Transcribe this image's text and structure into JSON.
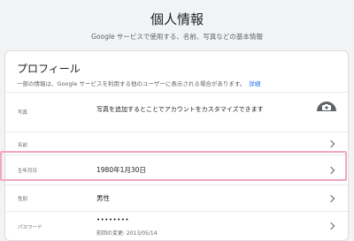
{
  "header": {
    "title": "個人情報",
    "subtitle": "Google サービスで使用する、名前、写真などの基本情報"
  },
  "profile": {
    "title": "プロフィール",
    "description": "一部の情報は、Google サービスを利用する他のユーザーに表示される場合があります。",
    "details_link": "詳細",
    "rows": [
      {
        "label": "写真",
        "value": "写真を追加するとことでアカウントをカスタマイズできます",
        "sub": ""
      },
      {
        "label": "名前",
        "value": "",
        "sub": ""
      },
      {
        "label": "生年月日",
        "value": "1980年1月30日",
        "sub": ""
      },
      {
        "label": "性別",
        "value": "男性",
        "sub": ""
      },
      {
        "label": "パスワード",
        "value": "••••••••",
        "sub": "前回の変更: 2013/05/14"
      }
    ]
  },
  "icons": {
    "camera": "camera-icon",
    "chevron": "chevron-right-icon"
  },
  "colors": {
    "highlight": "#f2a7c3",
    "link": "#1a73e8",
    "background": "#f1f3f4"
  }
}
